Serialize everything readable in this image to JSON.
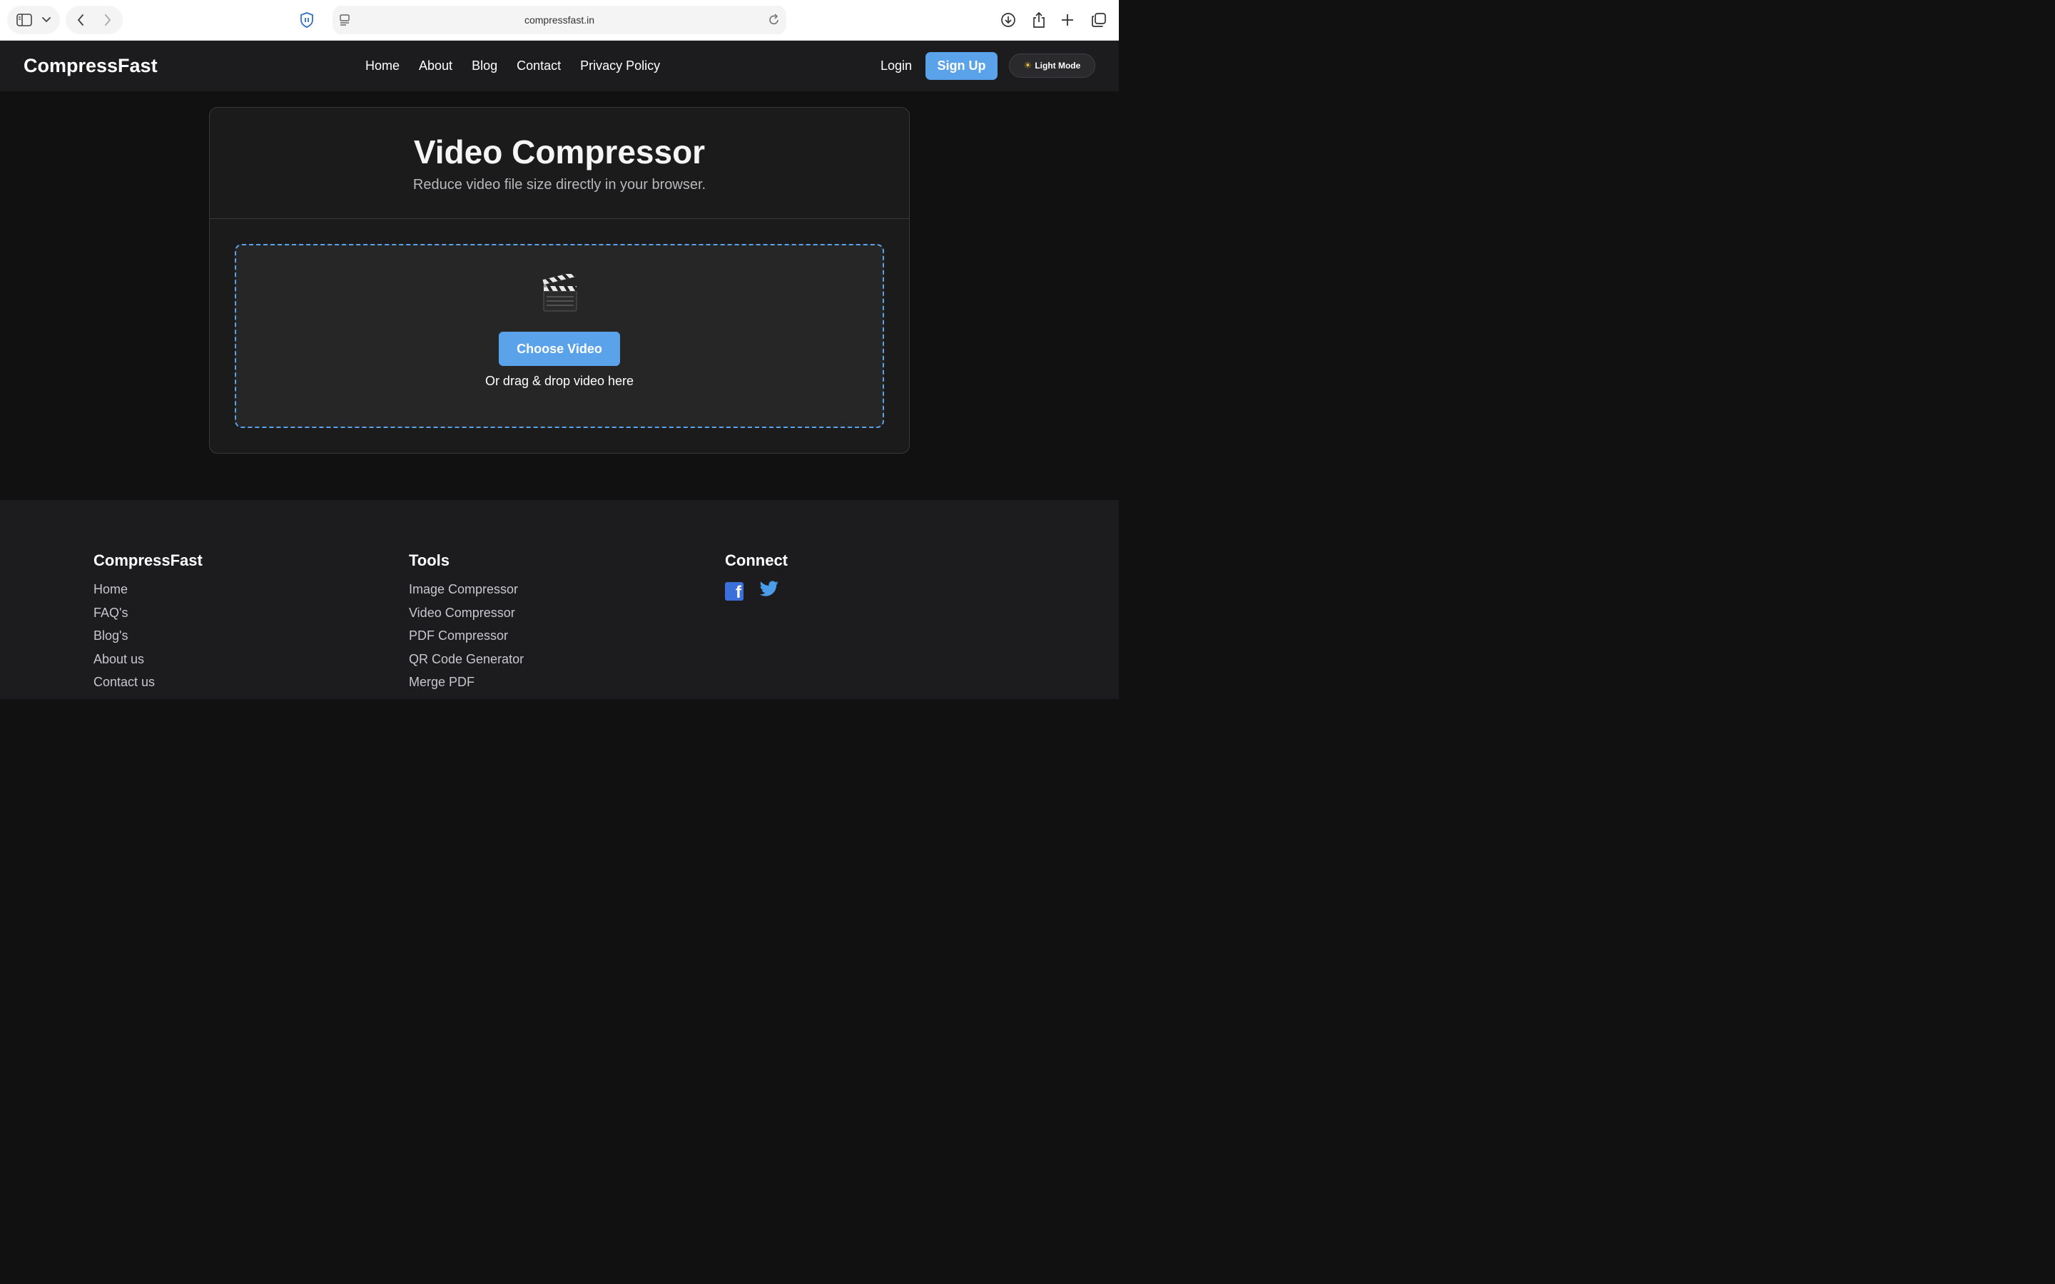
{
  "browser": {
    "url": "compressfast.in",
    "icons": [
      "sidebar-icon",
      "chevron-down-icon",
      "back-icon",
      "forward-icon",
      "shield-icon",
      "reader-icon",
      "reload-icon",
      "download-icon",
      "share-icon",
      "new-tab-icon",
      "tabs-overview-icon"
    ]
  },
  "nav": {
    "brand": "CompressFast",
    "links": [
      "Home",
      "About",
      "Blog",
      "Contact",
      "Privacy Policy"
    ],
    "login": "Login",
    "signup": "Sign Up",
    "theme_toggle": "Light Mode"
  },
  "main": {
    "title": "Video Compressor",
    "subtitle": "Reduce video file size directly in your browser.",
    "dropzone_icon": "clapper-board-icon",
    "choose_button": "Choose Video",
    "drag_text": "Or drag & drop video here"
  },
  "footer": {
    "brand": {
      "heading": "CompressFast",
      "links": [
        "Home",
        "FAQ's",
        "Blog's",
        "About us",
        "Contact us"
      ]
    },
    "tools": {
      "heading": "Tools",
      "links": [
        "Image Compressor",
        "Video Compressor",
        "PDF Compressor",
        "QR Code Generator",
        "Merge PDF"
      ]
    },
    "connect": {
      "heading": "Connect",
      "icons": [
        "facebook-icon",
        "twitter-icon"
      ]
    }
  },
  "colors": {
    "accent": "#5aa2ea",
    "background": "#111111",
    "surface": "#1c1c1e"
  }
}
